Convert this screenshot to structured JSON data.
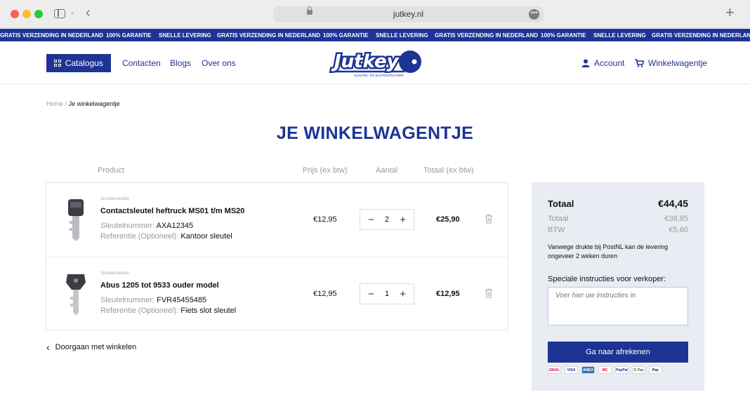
{
  "browser": {
    "url": "jutkey.nl"
  },
  "promo": [
    "GRATIS VERZENDING IN NEDERLAND",
    "100% GARANTIE",
    "SNELLE LEVERING",
    "GRATIS VERZENDING IN NEDERLAND",
    "100% GARANTIE",
    "SNELLE LEVERING",
    "GRATIS VERZENDING IN NEDERLAND",
    "100% GARANTIE",
    "SNELLE LEVERING",
    "GRATIS VERZENDING IN NEDERLAND",
    "100% GARANTIE"
  ],
  "header": {
    "catalog": "Catalogus",
    "nav": [
      "Contacten",
      "Blogs",
      "Over ons"
    ],
    "logo_text": "Jutkey",
    "logo_sub": "SLEUTEL- EN SLOTENTECHNIEK",
    "account": "Account",
    "cart": "Winkelwagentje"
  },
  "breadcrumb": {
    "home": "Home",
    "sep": "/",
    "current": "Je winkelwagentje"
  },
  "title": "JE WINKELWAGENTJE",
  "columns": {
    "product": "Product",
    "price": "Prijs (ex btw)",
    "quantity": "Aantal",
    "total": "Totaal (ex btw)"
  },
  "items": [
    {
      "category": "Scootersleutels",
      "name": "Contactsleutel heftruck MS01 t/m MS20",
      "key_label": "Sleutelnummer:",
      "key_value": "AXA12345",
      "ref_label": "Referentie (Optioneel):",
      "ref_value": "Kantoor sleutel",
      "price": "€12,95",
      "qty": "2",
      "total": "€25,90"
    },
    {
      "category": "Scootersleutels",
      "name": "Abus 1205 tot 9533 ouder model",
      "key_label": "Sleutelnummer:",
      "key_value": "FVR45455485",
      "ref_label": "Referentie (Optioneel):",
      "ref_value": "Fiets slot sleutel",
      "price": "€12,95",
      "qty": "1",
      "total": "€12,95"
    }
  ],
  "continue": "Doorgaan met winkelen",
  "summary": {
    "total_label": "Totaal",
    "total_value": "€44,45",
    "sub_label": "Totaal",
    "sub_value": "€38,85",
    "vat_label": "BTW",
    "vat_value": "€5,60",
    "notice": "Vanwege drukte bij PostNL kan de levering ongeveer 2 weken duren",
    "instructions_label": "Speciale instructies voor verkoper:",
    "instructions_placeholder": "Voer hier uw instructies in",
    "checkout": "Ga naar afrekenen"
  },
  "payments": [
    "iDEAL",
    "VISA",
    "AMEX",
    "MC",
    "PayPal",
    "G Pay",
    "Pay"
  ],
  "colors": {
    "brand": "#1d3494",
    "summary_bg": "#eaecf3"
  }
}
